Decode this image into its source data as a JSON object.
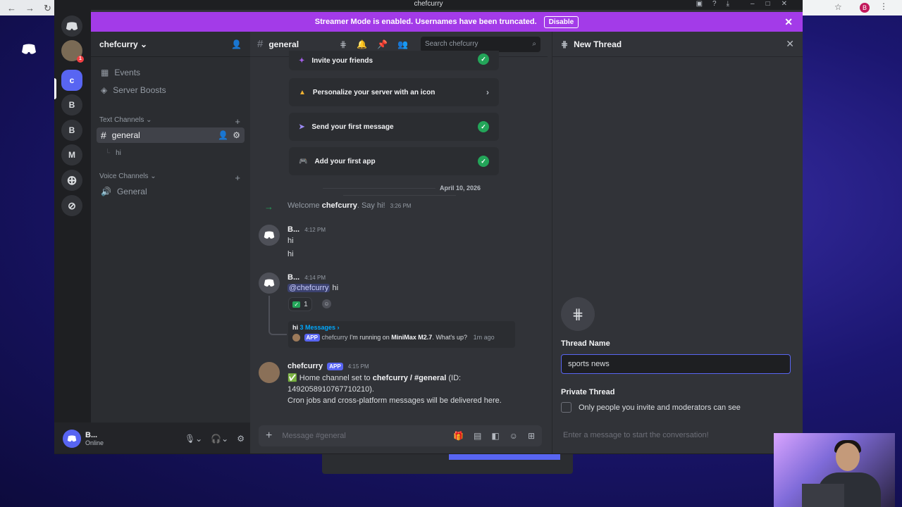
{
  "browser": {
    "tab_title": "chefcurry"
  },
  "window": {
    "title": "chefcurry"
  },
  "banner": {
    "text": "Streamer Mode is enabled. Usernames have been truncated.",
    "disable_label": "Disable"
  },
  "servers": [
    "c",
    "B",
    "B",
    "M"
  ],
  "guild": {
    "name": "chefcurry"
  },
  "sidebar": {
    "events": "Events",
    "boosts": "Server Boosts",
    "text_category": "Text Channels",
    "voice_category": "Voice Channels",
    "channel_general": "general",
    "thread_hi": "hi",
    "voice_general": "General"
  },
  "user": {
    "name": "B...",
    "status": "Online"
  },
  "chat": {
    "channel": "general",
    "search_placeholder": "Search chefcurry",
    "tasks": [
      {
        "label": "Invite your friends"
      },
      {
        "label": "Personalize your server with an icon"
      },
      {
        "label": "Send your first message"
      },
      {
        "label": "Add your first app"
      }
    ],
    "date_divider": "April 10, 2026",
    "welcome": {
      "prefix": "Welcome",
      "name": "chefcurry",
      "suffix": ". Say hi!",
      "time": "3:26 PM"
    },
    "msg1": {
      "author": "B...",
      "time": "4:12 PM",
      "line1": "hi",
      "line2": "hi"
    },
    "msg2": {
      "author": "B...",
      "time": "4:14 PM",
      "mention": "@chefcurry",
      "text": "hi",
      "reaction_count": "1"
    },
    "thread": {
      "name": "hi",
      "count": "3 Messages ›",
      "badge": "APP",
      "author": "chefcurry",
      "preview_pre": "I'm running on",
      "preview_bold": "MiniMax M2.7",
      "preview_post": ". What's up?",
      "time": "1m ago"
    },
    "msg3": {
      "author": "chefcurry",
      "badge": "APP",
      "time": "4:15 PM",
      "line1_pre": "✅ Home channel set to",
      "line1_bold": "chefcurry / #general",
      "line1_post": "(ID:",
      "line2": "1492058910767710210).",
      "line3": "Cron jobs and cross-platform messages will be delivered here."
    },
    "composer_placeholder": "Message #general"
  },
  "thread_panel": {
    "title": "New Thread",
    "name_label": "Thread Name",
    "name_value": "sports news",
    "private_label": "Private Thread",
    "private_desc": "Only people you invite and moderators can see",
    "composer_placeholder": "Enter a message to start the conversation!"
  },
  "colors": {
    "blurple": "#5865f2",
    "streamer": "#a33be8",
    "green": "#23a559"
  }
}
